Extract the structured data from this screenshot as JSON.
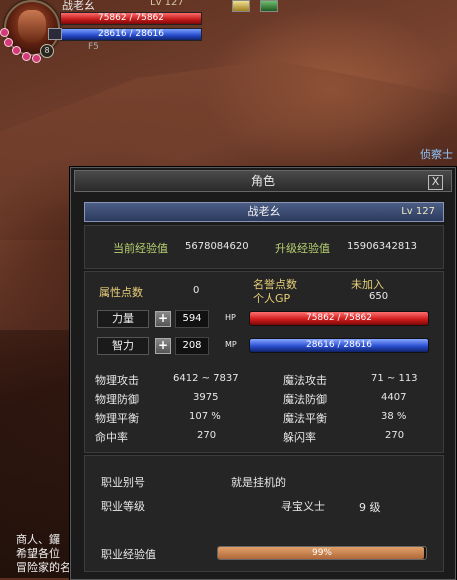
{
  "hud": {
    "name": "战老幺",
    "level": "Lv 127",
    "hp_text": "75862 / 75862",
    "mp_text": "28616 / 28616",
    "floor": "F5",
    "badge": "8"
  },
  "npc_label": "侦察士",
  "chat": {
    "lines": [
      "商人、鑼",
      "希望各位",
      "冒险家的名字"
    ]
  },
  "window": {
    "title": "角色",
    "close": "X",
    "char_name": "战老幺",
    "char_level": "Lv 127",
    "exp": {
      "current_label": "当前经验值",
      "current_value": "5678084620",
      "next_label": "升级经验值",
      "next_value": "15906342813"
    },
    "points": {
      "attr_label": "属性点数",
      "attr_value": "0",
      "fame_label": "名誉点数",
      "fame_value": "未加入",
      "gp_label": "个人GP",
      "gp_value": "650"
    },
    "stats": [
      {
        "name": "力量",
        "value": "594",
        "bar_tag": "HP",
        "bar_text": "75862 / 75862"
      },
      {
        "name": "智力",
        "value": "208",
        "bar_tag": "MP",
        "bar_text": "28616 / 28616"
      }
    ],
    "combat": {
      "phys_atk_label": "物理攻击",
      "phys_atk": "6412 ~ 7837",
      "mag_atk_label": "魔法攻击",
      "mag_atk": "71 ~ 113",
      "phys_def_label": "物理防御",
      "phys_def": "3975",
      "mag_def_label": "魔法防御",
      "mag_def": "4407",
      "phys_bal_label": "物理平衡",
      "phys_bal": "107 %",
      "mag_bal_label": "魔法平衡",
      "mag_bal": "38 %",
      "hit_label": "命中率",
      "hit": "270",
      "dodge_label": "躲闪率",
      "dodge": "270"
    },
    "job": {
      "alias_label": "职业别号",
      "alias_value": "就是挂机的",
      "level_label": "职业等级",
      "class_value": "寻宝义士",
      "level_value": "9 级",
      "exp_label": "职业经验值",
      "exp_text": "99%",
      "exp_progress": 0.99
    }
  },
  "colors": {
    "label_gold": "#e8d078",
    "label_green": "#b8d070",
    "hp": "#d01c1c",
    "mp": "#2a4ed0",
    "name_bar": "#3c4a72"
  }
}
